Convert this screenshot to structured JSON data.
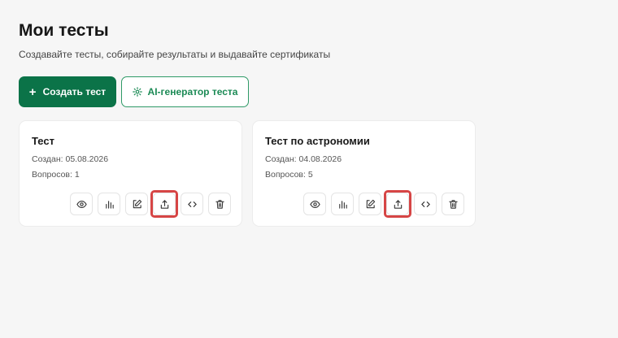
{
  "page": {
    "title": "Мои тесты",
    "subtitle": "Создавайте тесты, собирайте результаты и выдавайте сертификаты"
  },
  "toolbar": {
    "create_label": "Создать тест",
    "create_icon": "plus-icon",
    "ai_label": "AI-генератор теста",
    "ai_icon": "sparkle-icon"
  },
  "colors": {
    "primary": "#0b7348",
    "primary_text_outline": "#1b8a55",
    "highlight": "#d64545",
    "background": "#f6f6f6"
  },
  "cards": [
    {
      "title": "Тест",
      "created": "Создан: 05.08.2026",
      "questions": "Вопросов: 1"
    },
    {
      "title": "Тест по астрономии",
      "created": "Создан: 04.08.2026",
      "questions": "Вопросов: 5"
    }
  ],
  "card_actions": [
    {
      "icon": "eye-icon",
      "label": "view"
    },
    {
      "icon": "bar-chart-icon",
      "label": "results"
    },
    {
      "icon": "edit-icon",
      "label": "edit"
    },
    {
      "icon": "share-icon",
      "label": "share",
      "highlighted": true
    },
    {
      "icon": "code-icon",
      "label": "embed"
    },
    {
      "icon": "trash-icon",
      "label": "delete"
    }
  ]
}
